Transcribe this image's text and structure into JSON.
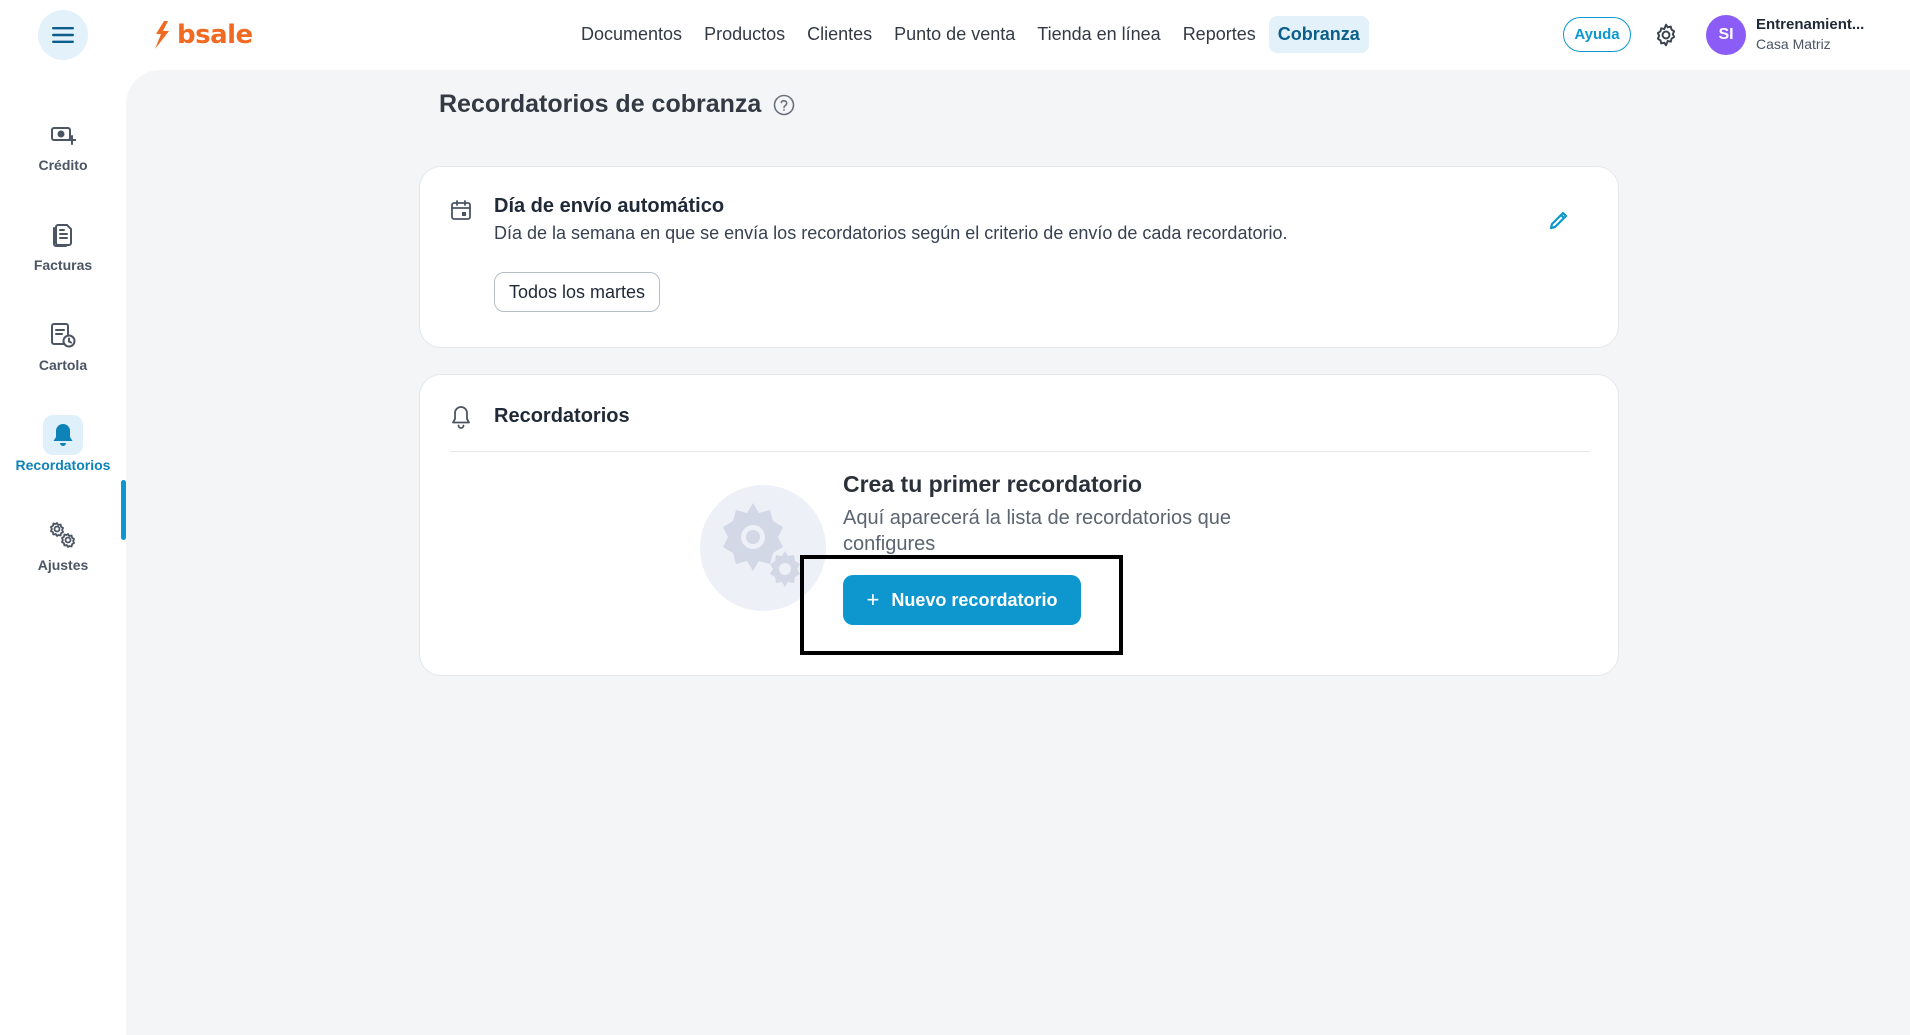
{
  "brand": {
    "logo_text": "bsale",
    "color": "#f26a21"
  },
  "topnav": {
    "items": [
      {
        "label": "Documentos"
      },
      {
        "label": "Productos"
      },
      {
        "label": "Clientes"
      },
      {
        "label": "Punto de venta"
      },
      {
        "label": "Tienda en línea"
      },
      {
        "label": "Reportes"
      },
      {
        "label": "Cobranza"
      }
    ],
    "active": "Cobranza",
    "help_label": "Ayuda"
  },
  "user": {
    "initials": "SI",
    "name": "Entrenamient...",
    "branch": "Casa Matriz",
    "avatar_color": "#8b5cf6"
  },
  "sidebar": {
    "items": [
      {
        "label": "Crédito",
        "icon": "money-plus-icon"
      },
      {
        "label": "Facturas",
        "icon": "documents-icon"
      },
      {
        "label": "Cartola",
        "icon": "statement-clock-icon"
      },
      {
        "label": "Recordatorios",
        "icon": "bell-icon"
      },
      {
        "label": "Ajustes",
        "icon": "gears-icon"
      }
    ],
    "active": "Recordatorios"
  },
  "page": {
    "title": "Recordatorios de cobranza"
  },
  "auto_send": {
    "title": "Día de envío automático",
    "description": "Día de la semana en que se envía los recordatorios según el criterio de envío de cada recordatorio.",
    "value": "Todos los martes"
  },
  "reminders": {
    "title": "Recordatorios",
    "empty_title": "Crea tu primer recordatorio",
    "empty_description": "Aquí aparecerá la lista de recordatorios que configures",
    "new_button_label": "Nuevo recordatorio"
  },
  "colors": {
    "accent": "#0e97cf",
    "accent_light": "#e3f1fa",
    "background": "#f4f5f7"
  }
}
